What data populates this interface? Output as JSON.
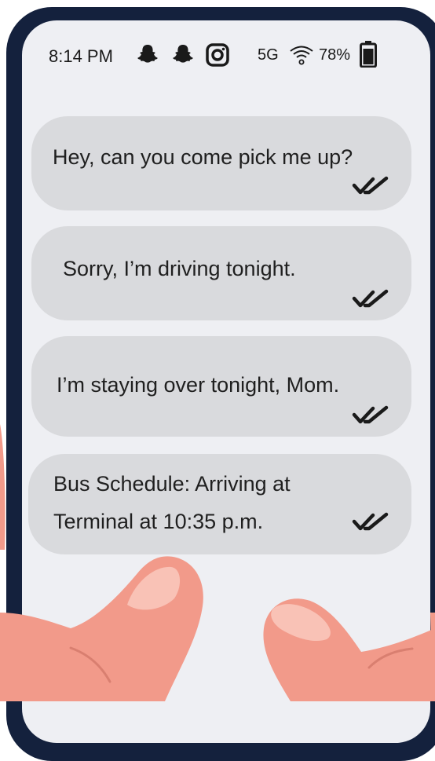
{
  "status_bar": {
    "time": "8:14 PM",
    "network": "5G",
    "battery": "78%",
    "icons": [
      "snapchat-icon",
      "snapchat-icon",
      "instagram-icon",
      "wifi-icon",
      "battery-icon"
    ]
  },
  "messages": [
    {
      "text": "Hey, can you come pick me up?",
      "status": "read"
    },
    {
      "text": "Sorry, I’m driving tonight.",
      "status": "read"
    },
    {
      "text": "I’m staying over tonight, Mom.",
      "status": "read"
    },
    {
      "lines": [
        "Bus Schedule: Arriving at",
        "Terminal at 10:35 p.m."
      ],
      "status": "read"
    }
  ],
  "colors": {
    "frame": "#14213d",
    "screen": "#eeeff3",
    "bubble": "#d9dadd",
    "text": "#1f1f1f",
    "skin": "#f29a8a"
  }
}
